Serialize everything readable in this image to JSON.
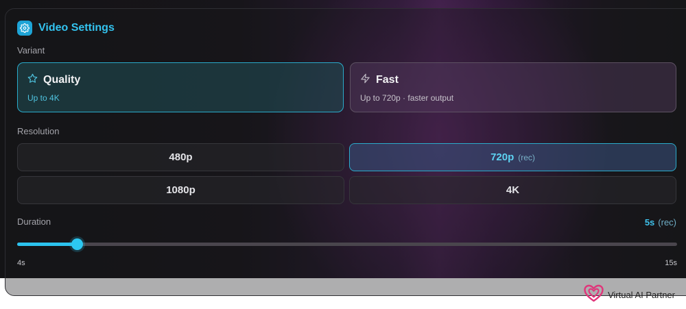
{
  "panel": {
    "title": "Video Settings",
    "title_icon": "gear-icon",
    "accent": "#33c3ef"
  },
  "variant": {
    "label": "Variant",
    "options": [
      {
        "name": "Quality",
        "subtitle": "Up to 4K",
        "icon": "star-icon",
        "selected": true
      },
      {
        "name": "Fast",
        "subtitle": "Up to 720p · faster output",
        "icon": "lightning-icon",
        "selected": false
      }
    ]
  },
  "resolution": {
    "label": "Resolution",
    "options": [
      {
        "value": "480p",
        "rec": "",
        "selected": false
      },
      {
        "value": "720p",
        "rec": "(rec)",
        "selected": true
      },
      {
        "value": "1080p",
        "rec": "",
        "selected": false
      },
      {
        "value": "4K",
        "rec": "",
        "selected": false
      }
    ]
  },
  "duration": {
    "label": "Duration",
    "current": "5s",
    "rec": "(rec)",
    "min_label": "4s",
    "max_label": "15s",
    "min": 4,
    "max": 15,
    "value": 5
  },
  "brand": {
    "name": "Virtual AI Partner",
    "logo_icon": "heart-logo-icon",
    "color": "#e0357a"
  }
}
